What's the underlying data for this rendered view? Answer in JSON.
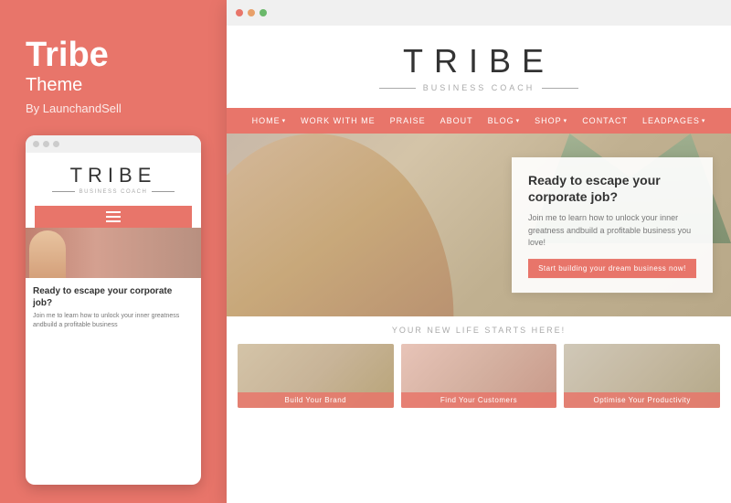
{
  "left": {
    "title": "Tribe",
    "subtitle": "Theme",
    "byline": "By LaunchandSell"
  },
  "mobile_preview": {
    "logo": {
      "tribe": "TRIBE",
      "biz_coach": "BUSINESS COACH"
    },
    "cta": {
      "title": "Ready to escape your corporate job?",
      "text": "Join me to learn how to unlock your inner greatness andbuild a profitable business"
    }
  },
  "website": {
    "logo": {
      "tribe": "TRIBE",
      "biz_coach": "BUSINESS COACH"
    },
    "nav": [
      {
        "label": "HOME",
        "has_chevron": true
      },
      {
        "label": "WORK WITH ME",
        "has_chevron": false
      },
      {
        "label": "PRAISE",
        "has_chevron": false
      },
      {
        "label": "ABOUT",
        "has_chevron": false
      },
      {
        "label": "BLOG",
        "has_chevron": true
      },
      {
        "label": "SHOP",
        "has_chevron": true
      },
      {
        "label": "CONTACT",
        "has_chevron": false
      },
      {
        "label": "LEADPAGES",
        "has_chevron": true
      }
    ],
    "hero": {
      "cta_title": "Ready to escape your corporate job?",
      "cta_text": "Join me to learn how to unlock your inner greatness andbuild a profitable business you love!",
      "cta_button": "Start building your dream business now!"
    },
    "bottom": {
      "tagline": "YOUR NEW LIFE STARTS HERE!",
      "cards": [
        {
          "label": "Build Your Brand"
        },
        {
          "label": "Find Your Customers"
        },
        {
          "label": "Optimise Your Productivity"
        }
      ]
    }
  }
}
